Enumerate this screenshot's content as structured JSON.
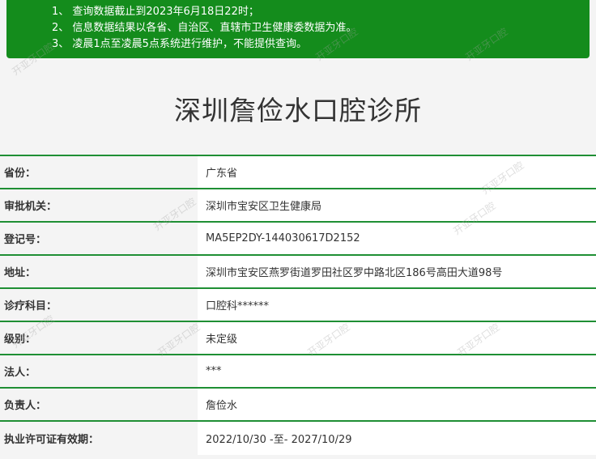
{
  "notice": {
    "lines": [
      "1、 查询数据截止到2023年6月18日22时；",
      "2、 信息数据结果以各省、自治区、直辖市卫生健康委数据为准。",
      "3、 凌晨1点至凌晨5点系统进行维护，不能提供查询。"
    ]
  },
  "page": {
    "title": "深圳詹俭水口腔诊所"
  },
  "details": [
    {
      "label": "省份：",
      "value": "广东省"
    },
    {
      "label": "审批机关：",
      "value": "深圳市宝安区卫生健康局"
    },
    {
      "label": "登记号：",
      "value": "MA5EP2DY-144030617D2152"
    },
    {
      "label": "地址：",
      "value": "深圳市宝安区燕罗街道罗田社区罗中路北区186号高田大道98号"
    },
    {
      "label": "诊疗科目：",
      "value": "口腔科******"
    },
    {
      "label": "级别：",
      "value": "未定级"
    },
    {
      "label": "法人：",
      "value": "***"
    },
    {
      "label": "负责人：",
      "value": "詹俭水"
    },
    {
      "label": "执业许可证有效期：",
      "value": "2022/10/30 -至- 2027/10/29"
    }
  ],
  "watermark": {
    "text": "开亚牙口腔"
  }
}
